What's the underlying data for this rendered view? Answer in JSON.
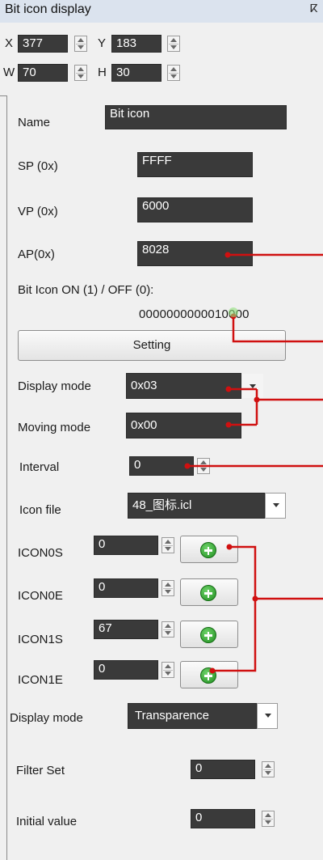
{
  "header": {
    "title": "Bit icon display",
    "pin_glyph": "ⴽ"
  },
  "coords": {
    "x_label": "X",
    "x_value": "377",
    "y_label": "Y",
    "y_value": "183",
    "w_label": "W",
    "w_value": "70",
    "h_label": "H",
    "h_value": "30"
  },
  "fields": {
    "name_label": "Name",
    "name_value": "Bit icon",
    "sp_label": "SP (0x)",
    "sp_value": "FFFF",
    "vp_label": "VP (0x)",
    "vp_value": "6000",
    "ap_label": "AP(0x)",
    "ap_value": "8028"
  },
  "bit_icon": {
    "label": "Bit Icon ON (1) / OFF (0):",
    "value": "0000000000010000"
  },
  "setting_button": "Setting",
  "display_mode": {
    "label": "Display mode",
    "value": "0x03"
  },
  "moving_mode": {
    "label": "Moving mode",
    "value": "0x00"
  },
  "interval": {
    "label": "Interval",
    "value": "0"
  },
  "icon_file": {
    "label": "Icon file",
    "value": "48_图标.icl"
  },
  "icons": [
    {
      "label": "ICON0S",
      "value": "0"
    },
    {
      "label": "ICON0E",
      "value": "0"
    },
    {
      "label": "ICON1S",
      "value": "67"
    },
    {
      "label": "ICON1E",
      "value": "0"
    }
  ],
  "display_mode2": {
    "label": "Display mode",
    "value": "Transparence"
  },
  "filter_set": {
    "label": "Filter Set",
    "value": "0"
  },
  "initial_value": {
    "label": "Initial value",
    "value": "0"
  },
  "colors": {
    "annotation": "#d01010",
    "dark_input": "#3a3a3a",
    "header_bg": "#dbe3ee",
    "plus_green": "#2fa82f"
  },
  "icon_names": [
    "pin-icon",
    "spin-up-icon",
    "spin-down-icon",
    "dropdown-arrow-icon",
    "add-icon"
  ]
}
